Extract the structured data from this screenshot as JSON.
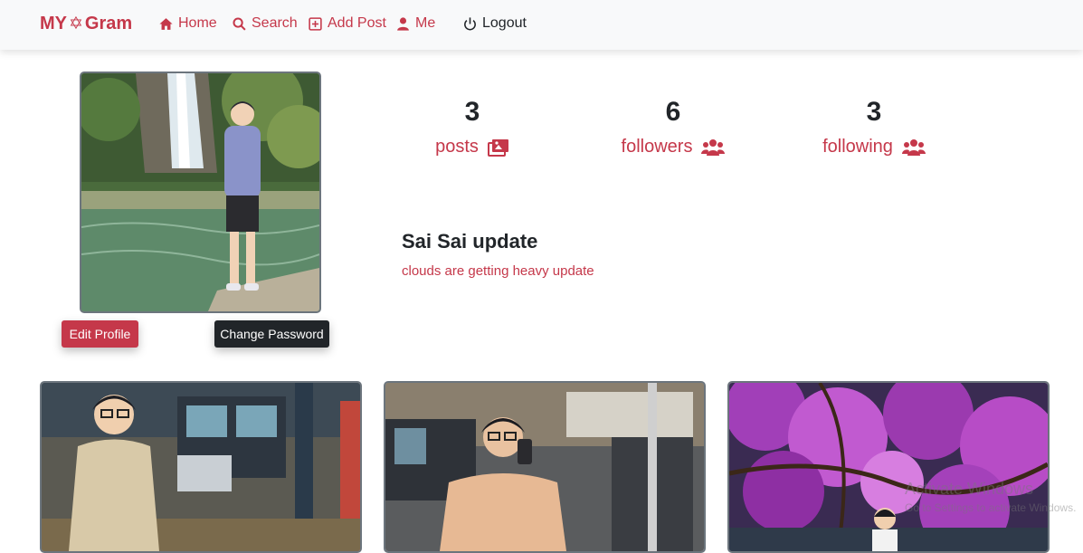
{
  "nav": {
    "brand_prefix": "MY",
    "brand_icon": "gear-icon",
    "brand_suffix": "Gram",
    "home_label": "Home",
    "search_label": "Search",
    "add_post_label": "Add Post",
    "me_label": "Me",
    "logout_label": "Logout",
    "accent_color": "#c5384a"
  },
  "profile": {
    "edit_label": "Edit Profile",
    "change_password_label": "Change Password",
    "stats": [
      {
        "value": "3",
        "label": "posts",
        "icon": "images-icon"
      },
      {
        "value": "6",
        "label": "followers",
        "icon": "users-icon"
      },
      {
        "value": "3",
        "label": "following",
        "icon": "users-icon"
      }
    ],
    "name": "Sai Sai update",
    "bio": "clouds are getting heavy update"
  },
  "watermark": {
    "line1": "Activate Windows",
    "line2": "Go to Settings to activate Windows."
  }
}
